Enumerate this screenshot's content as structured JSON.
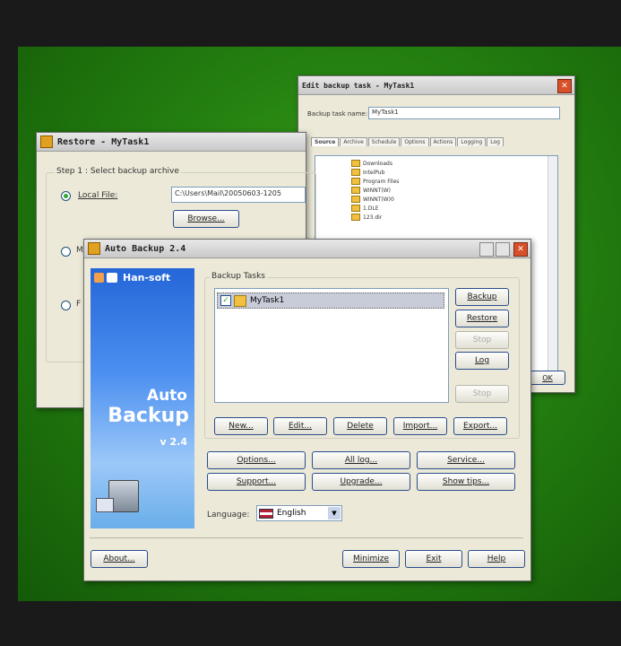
{
  "edit_window": {
    "title": "Edit backup task - MyTask1",
    "task_name_label": "Backup task name:",
    "task_name_value": "MyTask1",
    "tabs": [
      "Source",
      "Archive",
      "Schedule",
      "Options",
      "Actions",
      "Logging",
      "Log"
    ],
    "tree_items": [
      "Downloads",
      "IntelPub",
      "Program Files",
      "WINNT(W)",
      "WINNT(W)0",
      "1.DLE",
      "123.dir"
    ],
    "ok_label": "OK"
  },
  "restore_window": {
    "title": "Restore - MyTask1",
    "step_label": "Step 1 : Select backup archive",
    "local_file_label": "Local File:",
    "file_path": "C:\\Users\\Mail\\20050603-1205",
    "browse_label": "Browse...",
    "option2_label": "M",
    "option3_label": "F"
  },
  "main_window": {
    "title": "Auto Backup 2.4",
    "brand": "Han-soft",
    "product_line1": "Auto",
    "product_line2": "Backup",
    "version": "v 2.4",
    "group_label": "Backup Tasks",
    "tasks": [
      {
        "name": "MyTask1",
        "checked": true
      }
    ],
    "side_buttons": [
      {
        "label": "Backup",
        "enabled": true
      },
      {
        "label": "Restore",
        "enabled": true
      },
      {
        "label": "Stop",
        "enabled": false
      },
      {
        "label": "Log",
        "enabled": true
      },
      {
        "label": "Stop",
        "enabled": false
      }
    ],
    "task_buttons": [
      "New...",
      "Edit...",
      "Delete",
      "Import...",
      "Export..."
    ],
    "row1_buttons": [
      "Options...",
      "All log...",
      "Service..."
    ],
    "row2_buttons": [
      "Support...",
      "Upgrade...",
      "Show tips..."
    ],
    "language_label": "Language:",
    "language_value": "English",
    "about_label": "About...",
    "minimize_label": "Minimize",
    "exit_label": "Exit",
    "help_label": "Help"
  },
  "colors": {
    "desktop": "#248010",
    "accent_border": "#2a4d8c",
    "sidebar_blue": "#2566d8"
  }
}
